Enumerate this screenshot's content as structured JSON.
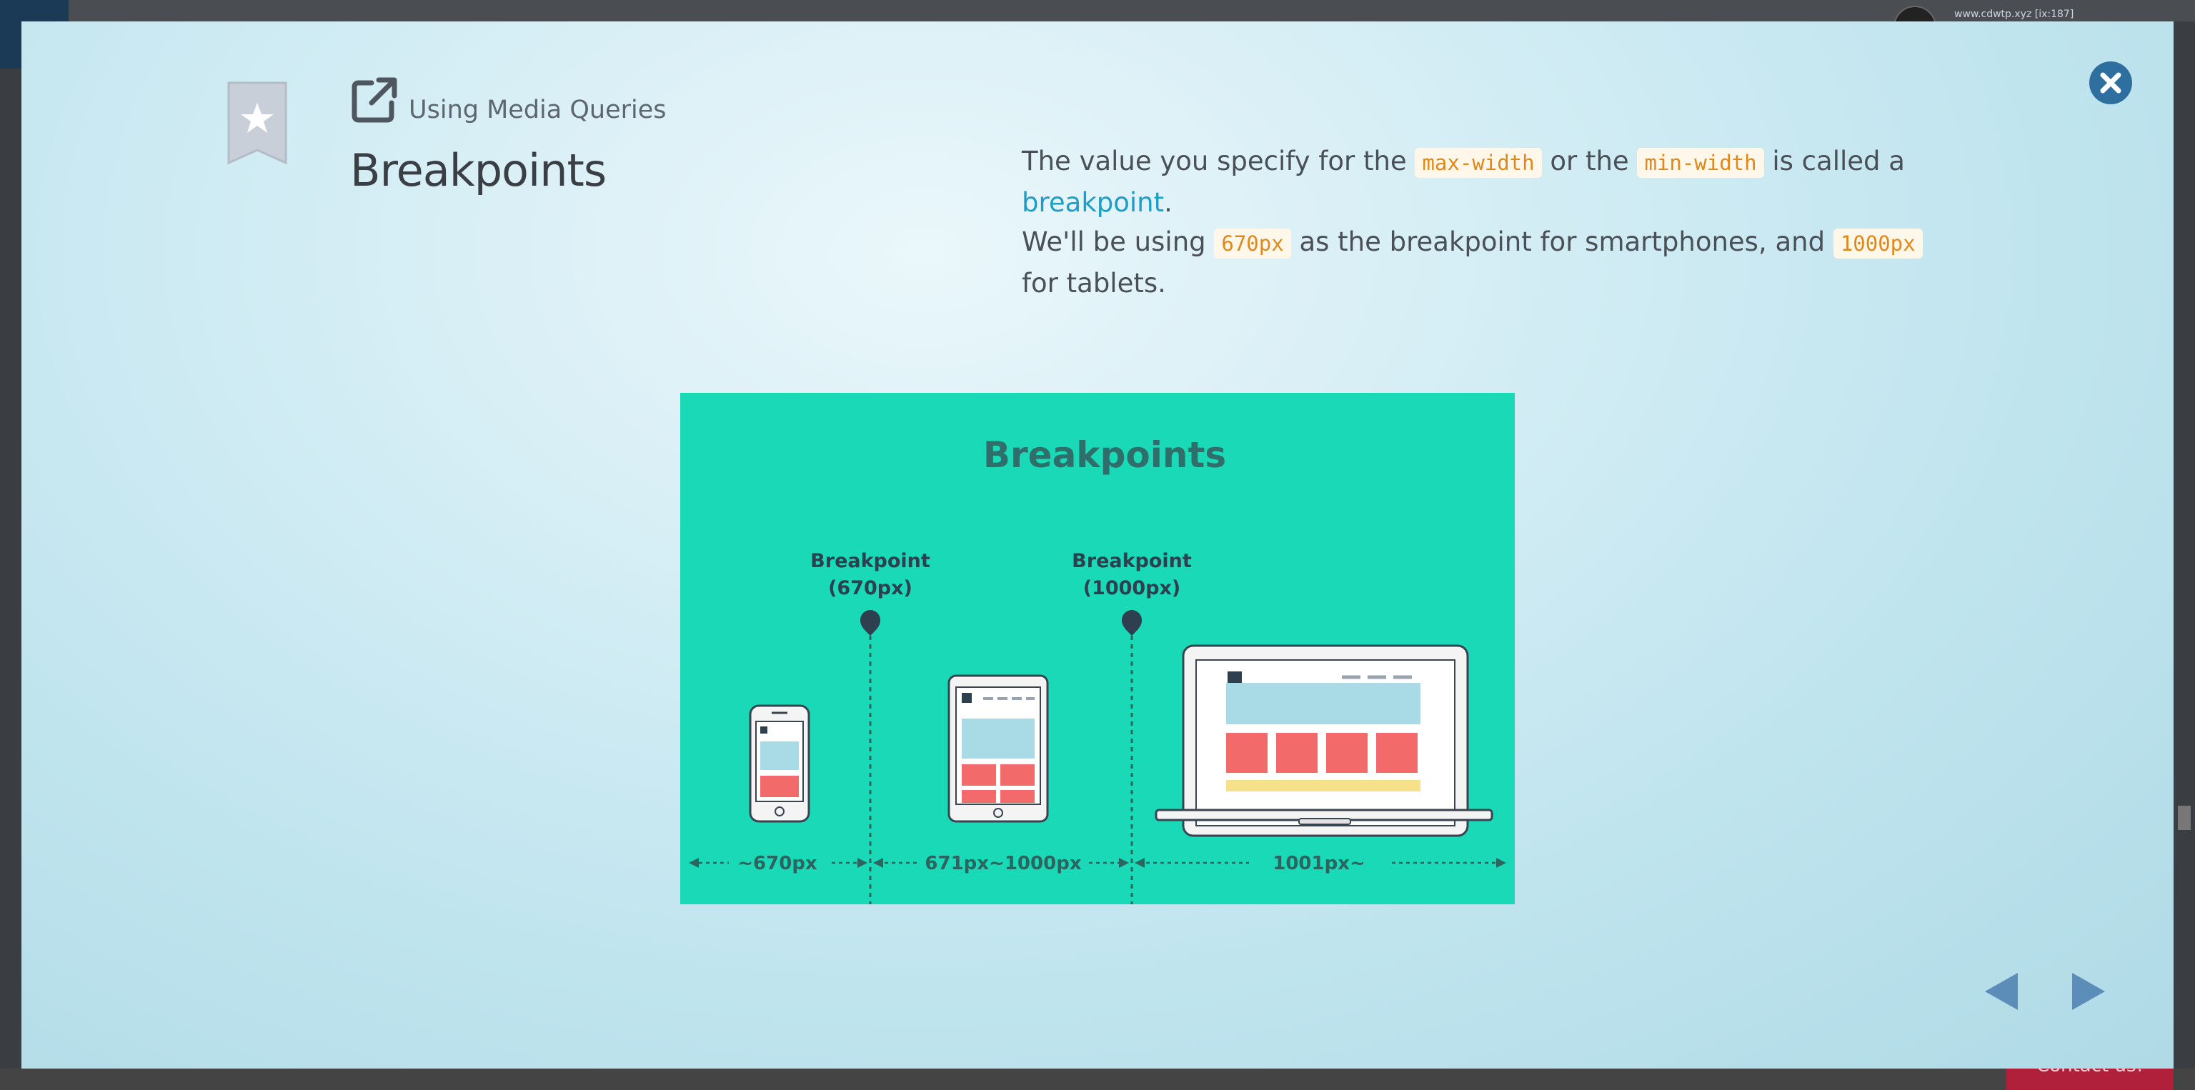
{
  "background": {
    "address_text": "www.cdwtp.xyz [ix:187]",
    "contact_label": "Contact us!"
  },
  "modal": {
    "section_label": "Using Media Queries",
    "title": "Breakpoints",
    "description": {
      "p1_a": "The value you specify for the ",
      "code_max_width": "max-width",
      "p1_b": " or the ",
      "code_min_width": "min-width",
      "p1_c": " is called a ",
      "link_breakpoint": "breakpoint",
      "p1_d": ".",
      "p2_a": "We'll be using ",
      "code_670": "670px",
      "p2_b": " as the breakpoint for smartphones, and ",
      "code_1000": "1000px",
      "p2_c": " for tablets."
    },
    "figure": {
      "title": "Breakpoints",
      "bp1_line1": "Breakpoint",
      "bp1_line2": "(670px)",
      "bp2_line1": "Breakpoint",
      "bp2_line2": "(1000px)",
      "range1": "~670px",
      "range2": "671px~1000px",
      "range3": "1001px~"
    }
  },
  "colors": {
    "figure_bg": "#19d9b6",
    "accent_link": "#1b9fc7",
    "code_text": "#e0891a",
    "close_button": "#2e6fa0",
    "nav_arrow": "#5b8db8"
  },
  "icons": {
    "bookmark": "bookmark-star-icon",
    "external_link": "external-link-icon",
    "close": "close-icon",
    "prev": "arrow-left-icon",
    "next": "arrow-right-icon"
  }
}
